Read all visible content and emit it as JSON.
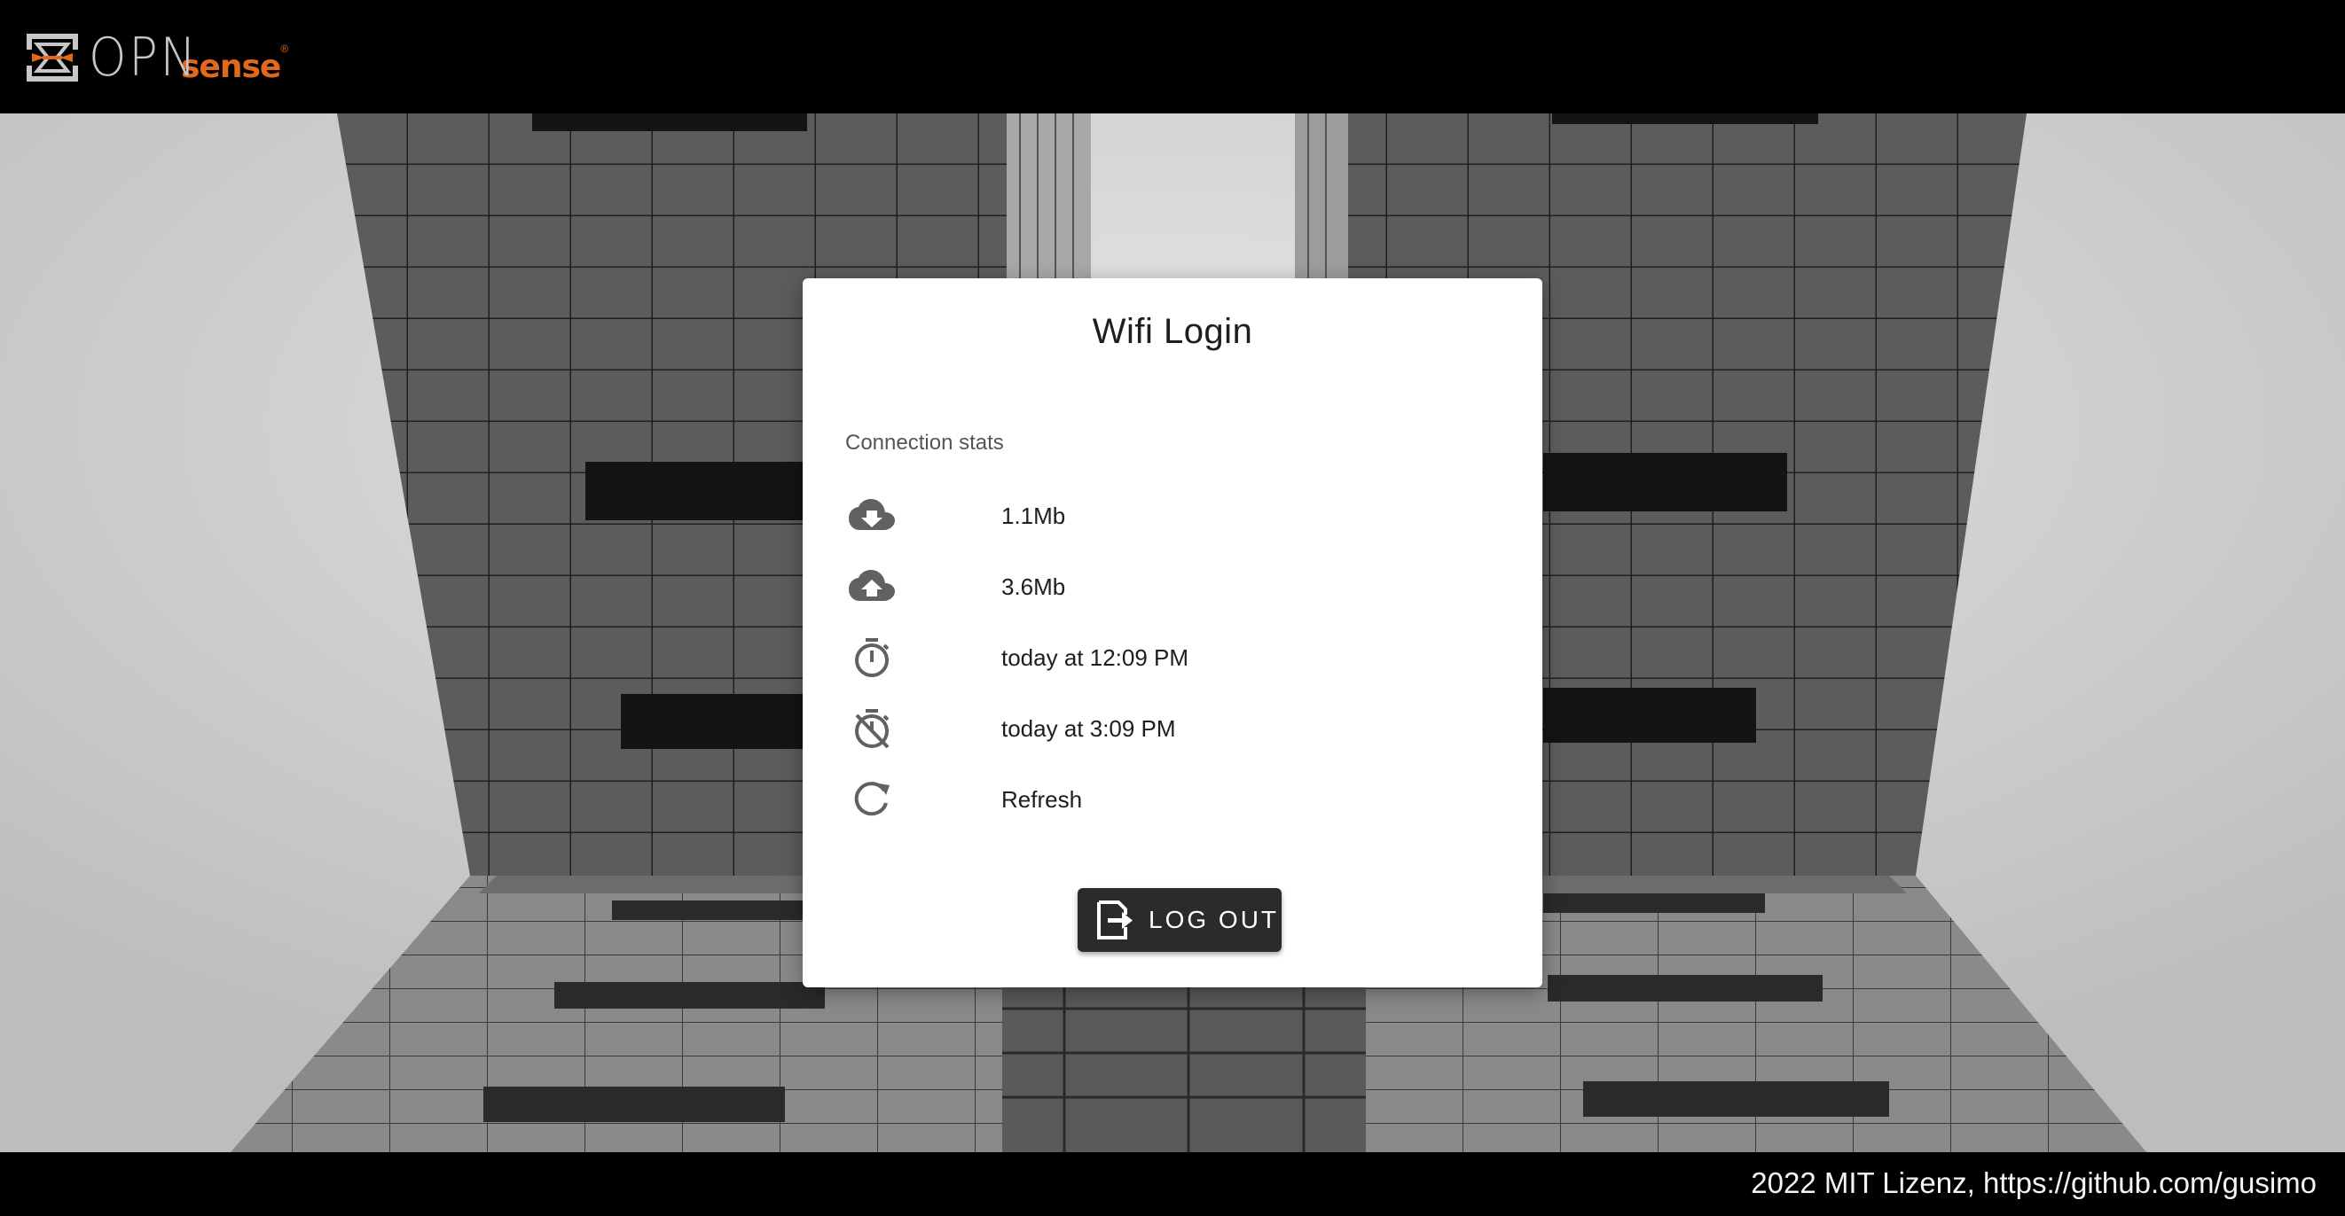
{
  "header": {
    "logo_opn": "OPN",
    "logo_sense": "sense",
    "logo_reg": "®",
    "logo_icon": "opnsense-logo-icon"
  },
  "card": {
    "title": "Wifi Login",
    "section_label": "Connection stats",
    "stats": [
      {
        "icon": "cloud-download-icon",
        "text": "1.1Mb"
      },
      {
        "icon": "cloud-upload-icon",
        "text": "3.6Mb"
      },
      {
        "icon": "timer-icon",
        "text": "today at 12:09 PM"
      },
      {
        "icon": "timer-off-icon",
        "text": "today at 3:09 PM"
      },
      {
        "icon": "refresh-icon",
        "text": "Refresh"
      }
    ],
    "logout_label": "LOG OUT",
    "logout_icon": "logout-icon"
  },
  "footer": {
    "text": "2022 MIT Lizenz, https://github.com/gusimo"
  },
  "colors": {
    "brand_orange": "#e2691b",
    "topbar": "#000000",
    "button": "#2b2b2b",
    "icon_gray": "#616161"
  }
}
